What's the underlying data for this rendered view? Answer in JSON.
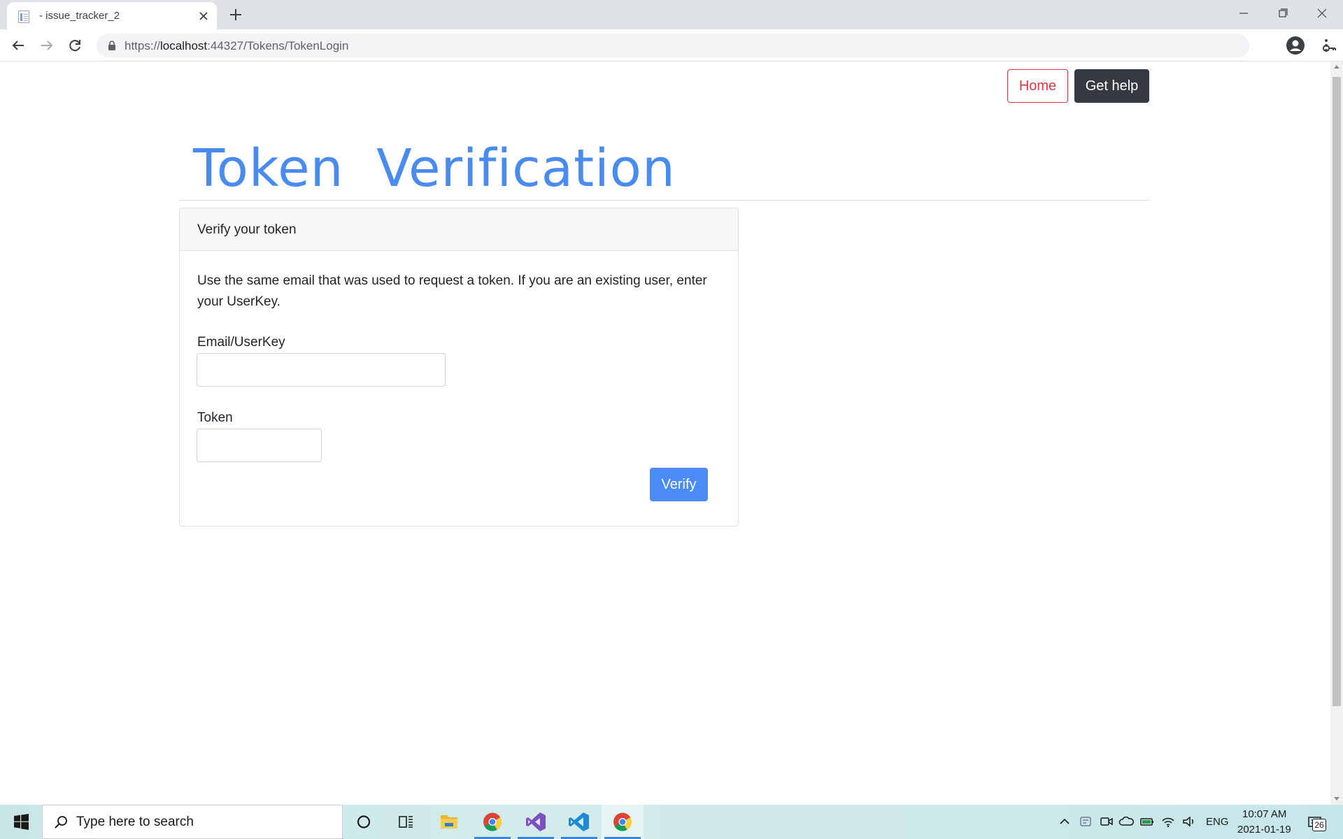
{
  "browser": {
    "tab_title": "- issue_tracker_2",
    "url_scheme": "https://",
    "url_host": "localhost",
    "url_path": ":44327/Tokens/TokenLogin"
  },
  "nav": {
    "home_label": "Home",
    "help_label": "Get help"
  },
  "page": {
    "title": "Token Verification",
    "card_header": "Verify your token",
    "intro": "Use the same email that was used to request a token. If you are an existing user, enter your UserKey.",
    "email_label": "Email/UserKey",
    "email_value": "",
    "token_label": "Token",
    "token_value": "",
    "verify_label": "Verify"
  },
  "taskbar": {
    "search_placeholder": "Type here to search",
    "language": "ENG",
    "time": "10:07 AM",
    "date": "2021-01-19",
    "notification_count": "26"
  },
  "colors": {
    "accent_blue": "#4a8bf0",
    "home_red": "#dc3545",
    "help_dark": "#343a40"
  }
}
